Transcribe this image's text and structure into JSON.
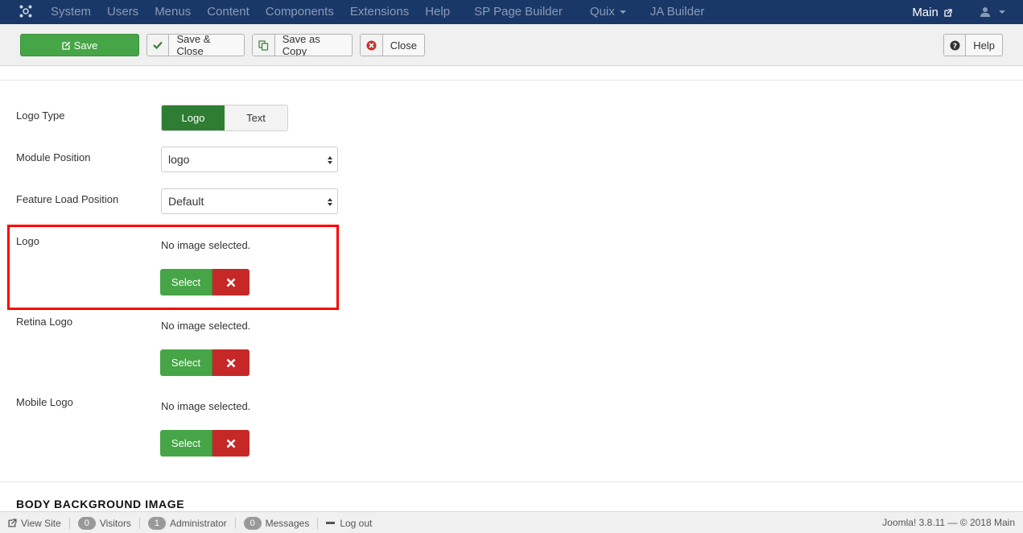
{
  "navbar": {
    "logo_icon": "joomla-logo-icon",
    "menu": [
      {
        "label": "System",
        "dropdown": false
      },
      {
        "label": "Users",
        "dropdown": false
      },
      {
        "label": "Menus",
        "dropdown": false
      },
      {
        "label": "Content",
        "dropdown": false
      },
      {
        "label": "Components",
        "dropdown": false
      },
      {
        "label": "Extensions",
        "dropdown": false
      },
      {
        "label": "Help",
        "dropdown": false
      },
      {
        "label": "SP Page Builder",
        "dropdown": false
      },
      {
        "label": "Quix",
        "dropdown": true
      },
      {
        "label": "JA Builder",
        "dropdown": false
      }
    ],
    "site_link": "Main",
    "user_icon": "user-icon"
  },
  "toolbar": {
    "save": "Save",
    "save_close": "Save & Close",
    "save_copy": "Save as Copy",
    "close": "Close",
    "help": "Help"
  },
  "form": {
    "logo_type": {
      "label": "Logo Type",
      "options": [
        "Logo",
        "Text"
      ],
      "selected": "Logo"
    },
    "module_position": {
      "label": "Module Position",
      "value": "logo"
    },
    "feature_load_position": {
      "label": "Feature Load Position",
      "value": "Default"
    },
    "media_fields": [
      {
        "label": "Logo",
        "status": "No image selected.",
        "select_label": "Select"
      },
      {
        "label": "Retina Logo",
        "status": "No image selected.",
        "select_label": "Select"
      },
      {
        "label": "Mobile Logo",
        "status": "No image selected.",
        "select_label": "Select"
      }
    ],
    "section_title": "BODY BACKGROUND IMAGE"
  },
  "statusbar": {
    "view_site": "View Site",
    "visitors_count": "0",
    "visitors": "Visitors",
    "admin_count": "1",
    "admin": "Administrator",
    "messages_count": "0",
    "messages": "Messages",
    "logout": "Log out",
    "version": "Joomla! 3.8.11  —  © 2018 Main"
  },
  "colors": {
    "navbar": "#1a3867",
    "success": "#46a546",
    "danger": "#c52827",
    "highlight": "#ff0000"
  }
}
